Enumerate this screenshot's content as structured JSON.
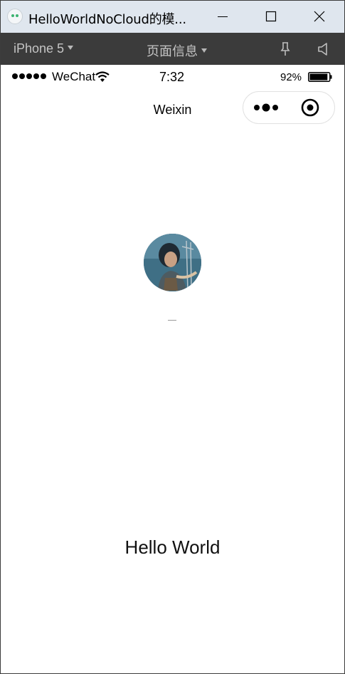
{
  "window": {
    "title": "HelloWorldNoCloud的模...",
    "icon": "wechat-devtools-icon"
  },
  "toolbar": {
    "device": "iPhone 5",
    "page_info": "页面信息"
  },
  "status_bar": {
    "carrier": "WeChat",
    "time": "7:32",
    "battery": "92%",
    "battery_level": 0.92
  },
  "nav": {
    "title": "Weixin"
  },
  "content": {
    "greeting": "Hello World"
  },
  "colors": {
    "titlebar": "#dfe6ee",
    "toolbar": "#3b3b3b",
    "screen": "#ffffff"
  }
}
